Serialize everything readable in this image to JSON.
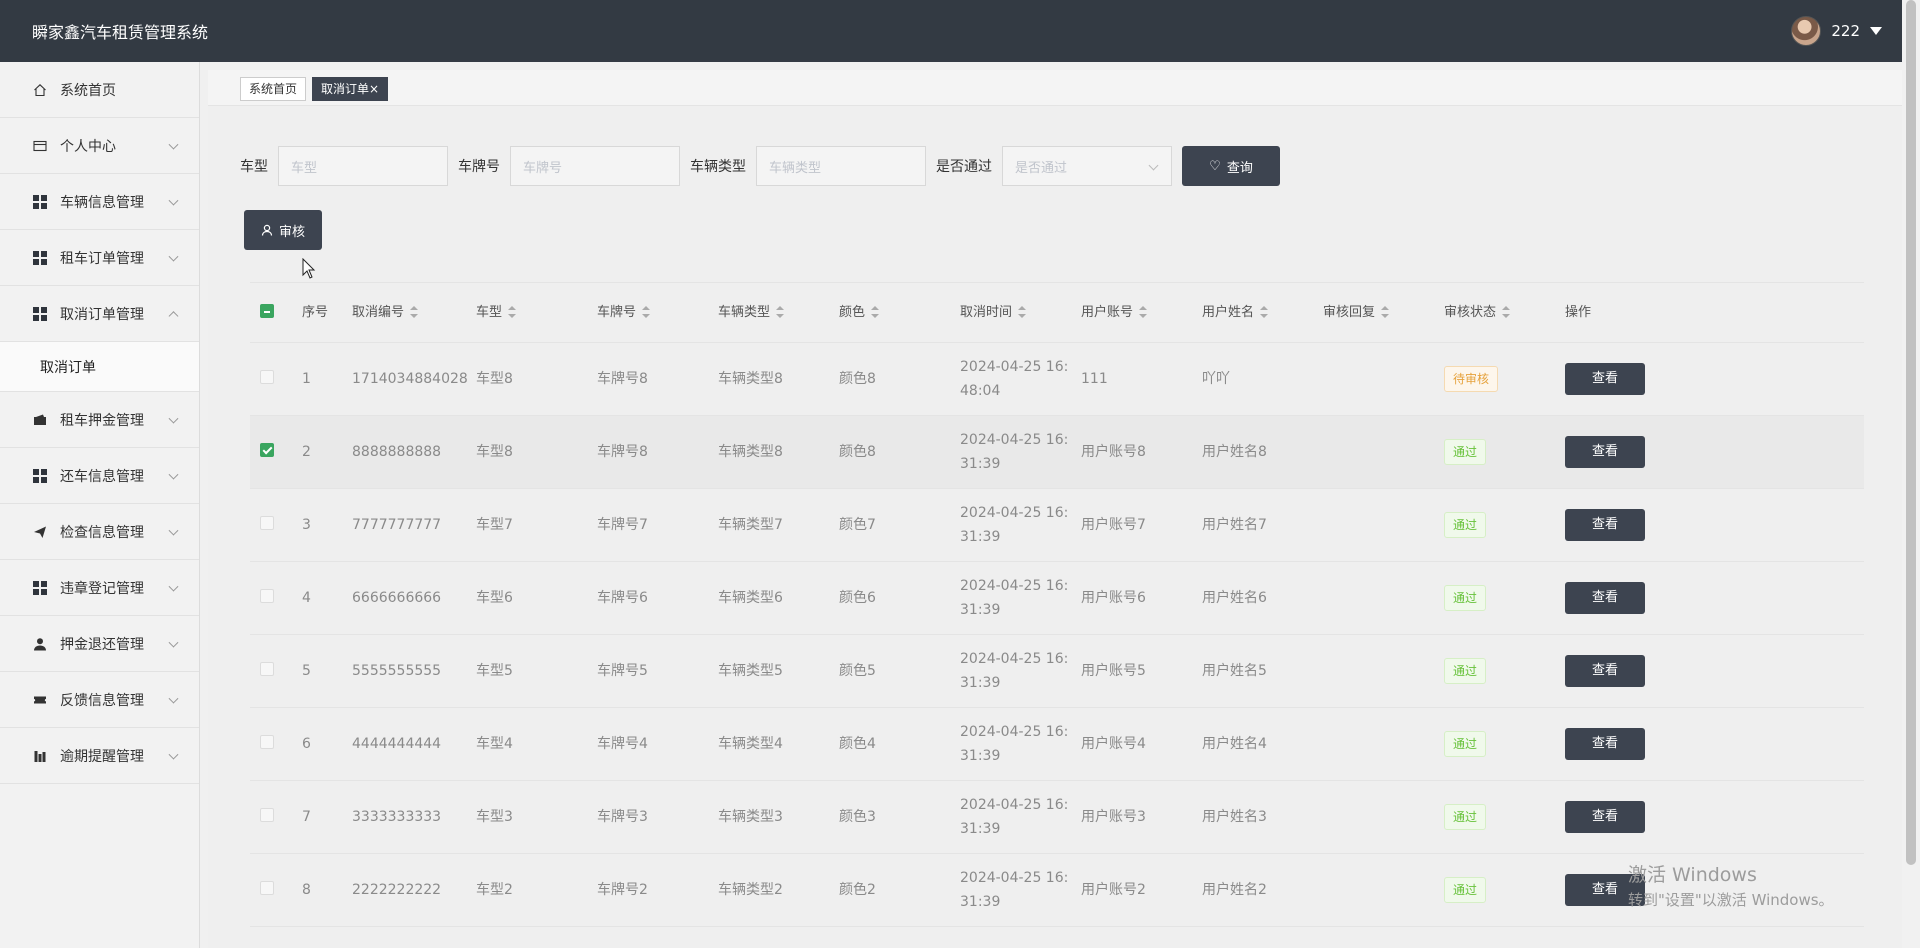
{
  "app": {
    "title": "瞬家鑫汽车租赁管理系统",
    "username": "222"
  },
  "sidebar": {
    "items": [
      {
        "label": "系统首页",
        "icon": "home-icon"
      },
      {
        "label": "个人中心",
        "icon": "card-icon"
      },
      {
        "label": "车辆信息管理",
        "icon": "grid-icon"
      },
      {
        "label": "租车订单管理",
        "icon": "grid-icon"
      },
      {
        "label": "取消订单管理",
        "icon": "grid-icon",
        "expanded": true
      },
      {
        "label": "租车押金管理",
        "icon": "wallet-icon"
      },
      {
        "label": "还车信息管理",
        "icon": "grid-icon"
      },
      {
        "label": "检查信息管理",
        "icon": "send-icon"
      },
      {
        "label": "违章登记管理",
        "icon": "grid-icon"
      },
      {
        "label": "押金退还管理",
        "icon": "user-icon"
      },
      {
        "label": "反馈信息管理",
        "icon": "ticket-icon"
      },
      {
        "label": "逾期提醒管理",
        "icon": "chart-icon"
      }
    ],
    "subitem": "取消订单"
  },
  "tabs": {
    "home": "系统首页",
    "active": "取消订单×"
  },
  "search": {
    "model_label": "车型",
    "model_placeholder": "车型",
    "plate_label": "车牌号",
    "plate_placeholder": "车牌号",
    "type_label": "车辆类型",
    "type_placeholder": "车辆类型",
    "pass_label": "是否通过",
    "pass_placeholder": "是否通过",
    "query_button": "查询"
  },
  "audit_button": "审核",
  "table": {
    "headers": [
      "序号",
      "取消编号",
      "车型",
      "车牌号",
      "车辆类型",
      "颜色",
      "取消时间",
      "用户账号",
      "用户姓名",
      "审核回复",
      "审核状态",
      "操作"
    ],
    "rows": [
      {
        "idx": "1",
        "no": "1714034884028",
        "model": "车型8",
        "plate": "车牌号8",
        "type": "车辆类型8",
        "color": "颜色8",
        "time": "2024-04-25 16:48:04",
        "account": "111",
        "name": "吖吖",
        "reply": "",
        "status": "待审核",
        "action": "查看",
        "checked": false
      },
      {
        "idx": "2",
        "no": "8888888888",
        "model": "车型8",
        "plate": "车牌号8",
        "type": "车辆类型8",
        "color": "颜色8",
        "time": "2024-04-25 16:31:39",
        "account": "用户账号8",
        "name": "用户姓名8",
        "reply": "",
        "status": "通过",
        "action": "查看",
        "checked": true
      },
      {
        "idx": "3",
        "no": "7777777777",
        "model": "车型7",
        "plate": "车牌号7",
        "type": "车辆类型7",
        "color": "颜色7",
        "time": "2024-04-25 16:31:39",
        "account": "用户账号7",
        "name": "用户姓名7",
        "reply": "",
        "status": "通过",
        "action": "查看",
        "checked": false
      },
      {
        "idx": "4",
        "no": "6666666666",
        "model": "车型6",
        "plate": "车牌号6",
        "type": "车辆类型6",
        "color": "颜色6",
        "time": "2024-04-25 16:31:39",
        "account": "用户账号6",
        "name": "用户姓名6",
        "reply": "",
        "status": "通过",
        "action": "查看",
        "checked": false
      },
      {
        "idx": "5",
        "no": "5555555555",
        "model": "车型5",
        "plate": "车牌号5",
        "type": "车辆类型5",
        "color": "颜色5",
        "time": "2024-04-25 16:31:39",
        "account": "用户账号5",
        "name": "用户姓名5",
        "reply": "",
        "status": "通过",
        "action": "查看",
        "checked": false
      },
      {
        "idx": "6",
        "no": "4444444444",
        "model": "车型4",
        "plate": "车牌号4",
        "type": "车辆类型4",
        "color": "颜色4",
        "time": "2024-04-25 16:31:39",
        "account": "用户账号4",
        "name": "用户姓名4",
        "reply": "",
        "status": "通过",
        "action": "查看",
        "checked": false
      },
      {
        "idx": "7",
        "no": "3333333333",
        "model": "车型3",
        "plate": "车牌号3",
        "type": "车辆类型3",
        "color": "颜色3",
        "time": "2024-04-25 16:31:39",
        "account": "用户账号3",
        "name": "用户姓名3",
        "reply": "",
        "status": "通过",
        "action": "查看",
        "checked": false
      },
      {
        "idx": "8",
        "no": "2222222222",
        "model": "车型2",
        "plate": "车牌号2",
        "type": "车辆类型2",
        "color": "颜色2",
        "time": "2024-04-25 16:31:39",
        "account": "用户账号2",
        "name": "用户姓名2",
        "reply": "",
        "status": "通过",
        "action": "查看",
        "checked": false
      }
    ]
  },
  "watermark": {
    "line1": "激活 Windows",
    "line2": "转到\"设置\"以激活 Windows。"
  }
}
